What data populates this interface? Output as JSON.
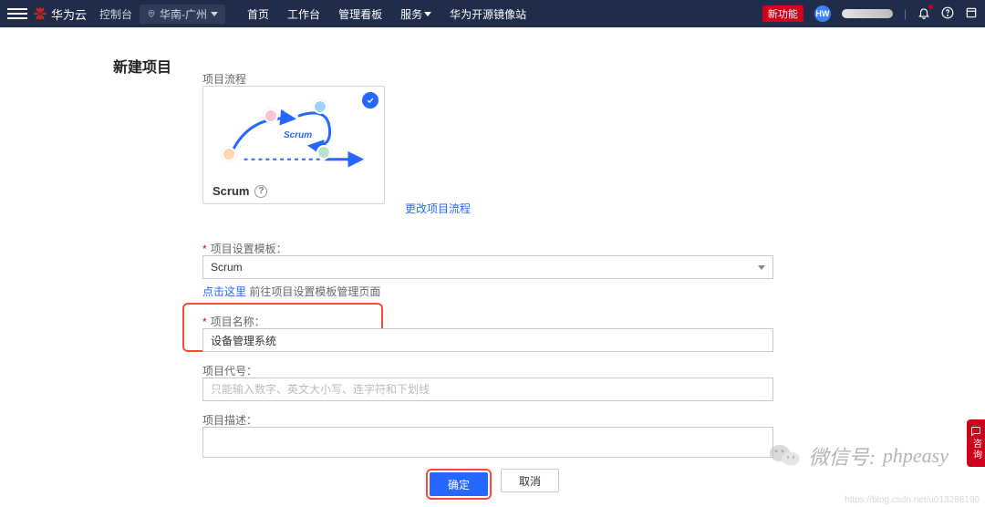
{
  "colors": {
    "accent": "#2667ff",
    "danger": "#d0021b",
    "highlight_border": "#ff4a3b"
  },
  "topbar": {
    "brand": "华为云",
    "console_tab": "控制台",
    "region": "华南-广州",
    "nav": {
      "home": "首页",
      "workbench": "工作台",
      "board": "管理看板",
      "services": "服务",
      "mirror": "华为开源镜像站"
    },
    "new_feature_badge": "新功能",
    "avatar_initials": "HW"
  },
  "page": {
    "title": "新建项目",
    "flow": {
      "group_label": "项目流程",
      "card_title": "Scrum",
      "center_caption": "Scrum",
      "change_link": "更改项目流程"
    },
    "template": {
      "label": "项目设置模板：",
      "selected": "Scrum",
      "hint_prefix": "点击这里",
      "hint_suffix": " 前往项目设置模板管理页面"
    },
    "name": {
      "label": "项目名称：",
      "value": "设备管理系统"
    },
    "code": {
      "label": "项目代号：",
      "placeholder": "只能输入数字、英文大小写、连字符和下划线"
    },
    "description": {
      "label": "项目描述："
    },
    "buttons": {
      "confirm": "确定",
      "cancel": "取消"
    }
  },
  "side": {
    "consult": "咨询"
  },
  "watermark": {
    "label": "微信号:",
    "handle": "phpeasy"
  },
  "footer_url": "https://blog.csdn.net/u013288190"
}
